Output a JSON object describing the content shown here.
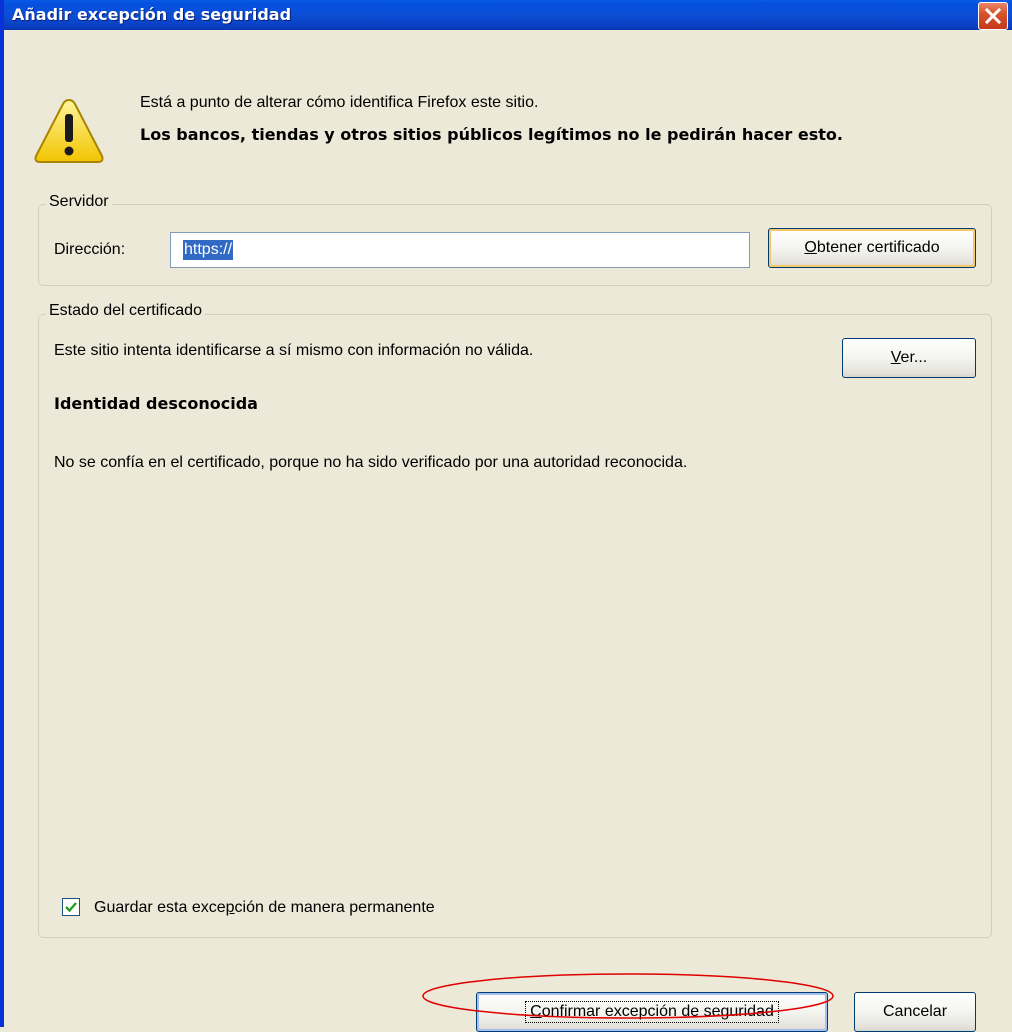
{
  "window": {
    "title": "Añadir excepción de seguridad",
    "close_icon": "close-x-icon"
  },
  "warning": {
    "icon": "warning-triangle-icon",
    "message": "Está a punto de alterar cómo identifica Firefox este sitio.",
    "bold_message": "Los bancos, tiendas y otros sitios públicos legítimos no le pedirán hacer esto."
  },
  "server": {
    "legend": "Servidor",
    "address_label": "Dirección:",
    "address_value": "https://",
    "get_certificate_button": {
      "prefix": "",
      "mnemonic": "O",
      "rest": "btener certificado"
    }
  },
  "certificate_status": {
    "legend": "Estado del certificado",
    "description": "Este sitio intenta identificarse a sí mismo con información no válida.",
    "view_button": {
      "prefix": "",
      "mnemonic": "V",
      "rest": "er..."
    },
    "identity_heading": "Identidad desconocida",
    "identity_detail": "No se confía en el certificado, porque no ha sido verificado por una autoridad reconocida."
  },
  "permanent_checkbox": {
    "checked": true,
    "label_prefix": "Guardar esta exce",
    "label_mnemonic": "p",
    "label_rest": "ción de manera permanente"
  },
  "buttons": {
    "confirm": {
      "prefix": "",
      "mnemonic": "C",
      "rest": "onfirmar excepción de seguridad"
    },
    "cancel": "Cancelar"
  },
  "colors": {
    "titlebar": "#0b4ed6",
    "dialog_bg": "#ece9d8",
    "selection": "#316ac5",
    "annotation_ellipse": "#e00000"
  }
}
